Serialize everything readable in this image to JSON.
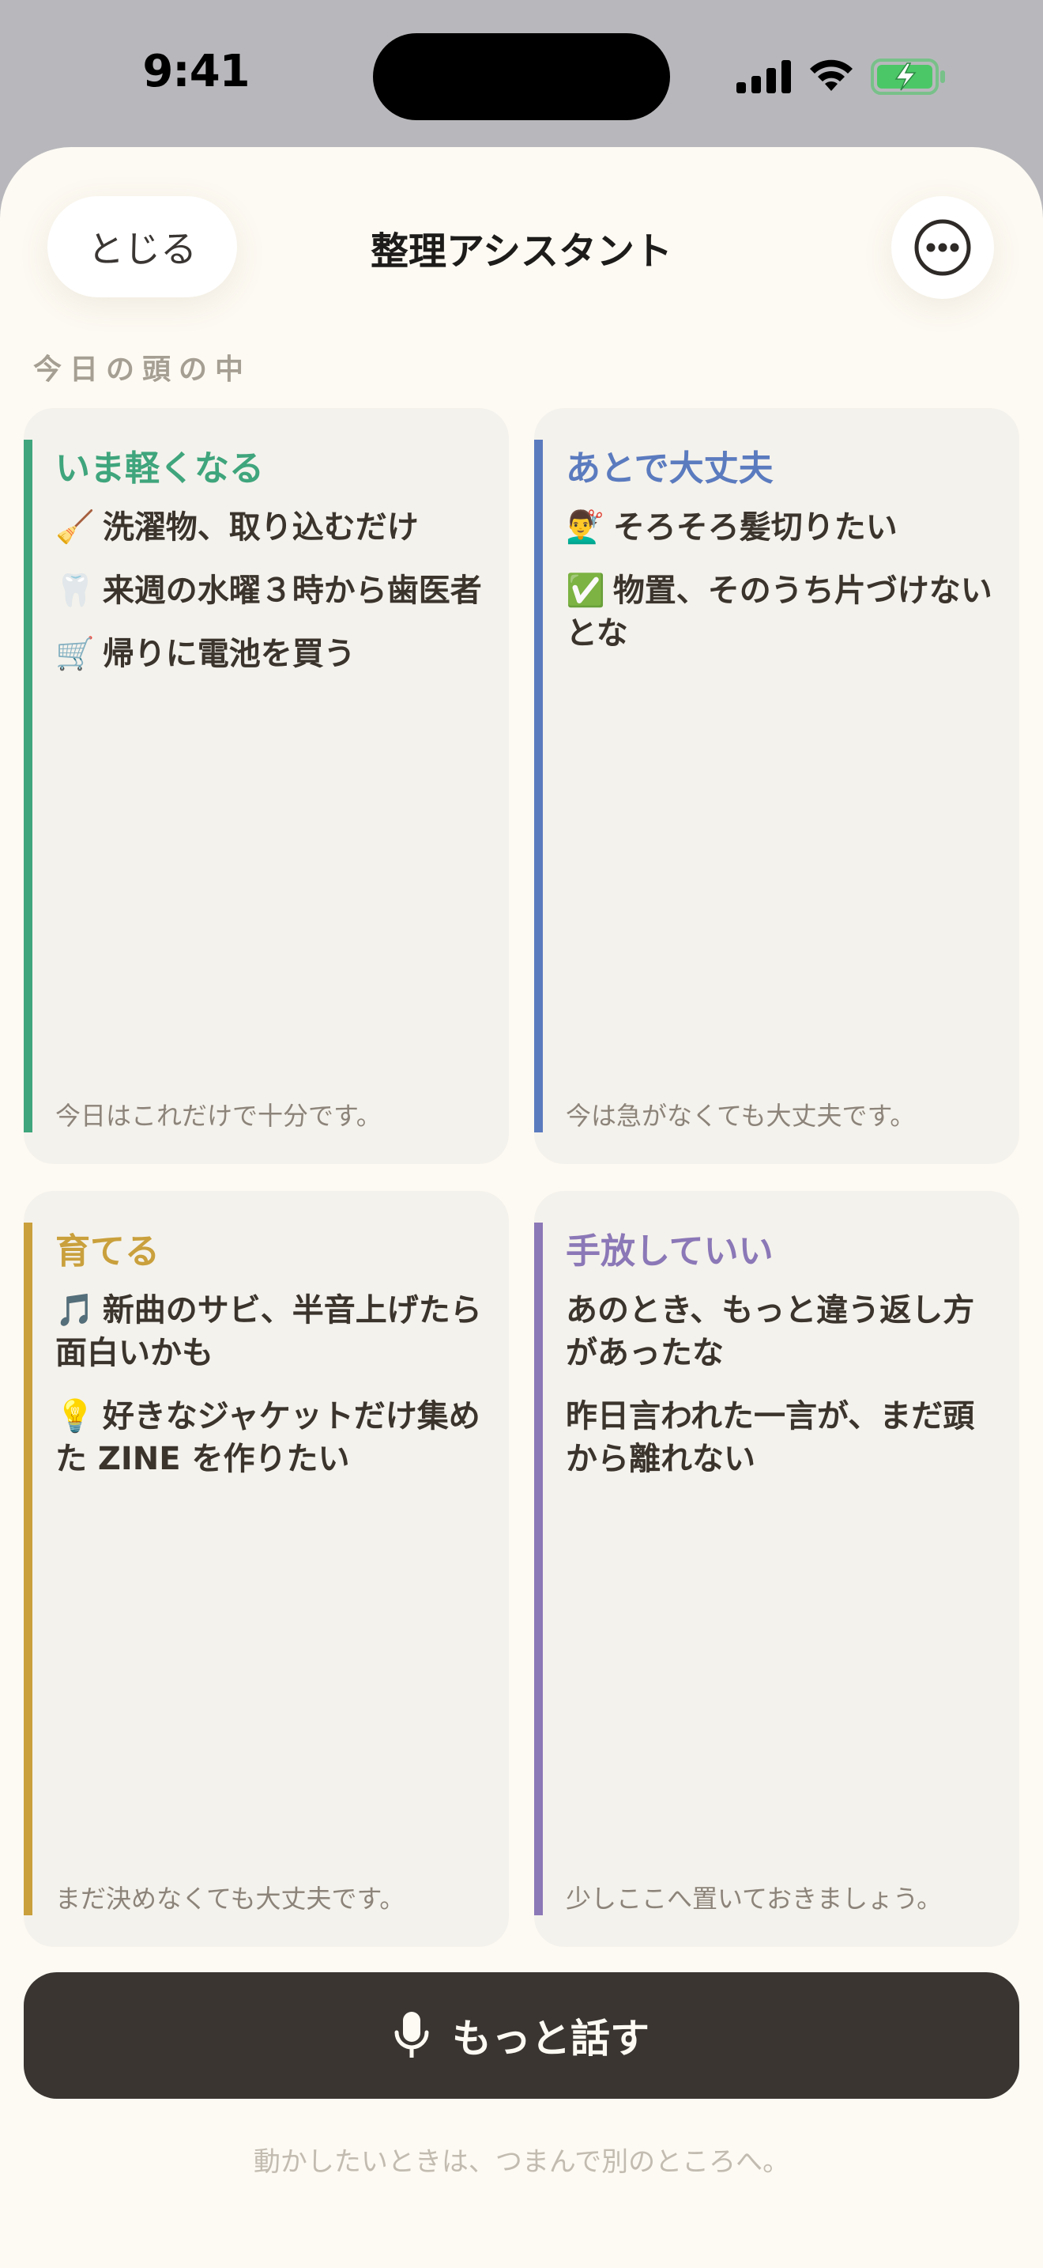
{
  "status_bar": {
    "time": "9:41",
    "icons": [
      "signal-icon",
      "wifi-icon",
      "battery-charging-icon"
    ],
    "battery_color": "#4cc767"
  },
  "header": {
    "close_label": "とじる",
    "title": "整理アシスタント",
    "more_icon": "ellipsis-circle-icon"
  },
  "section_label": "今日の頭の中",
  "cards": {
    "now": {
      "title": "いま軽くなる",
      "accent": "#3fa57c",
      "items": [
        {
          "emoji": "🧹",
          "text": "洗濯物、取り込むだけ"
        },
        {
          "emoji": "🦷",
          "text": "来週の水曜３時から歯医者"
        },
        {
          "emoji": "🛒",
          "text": "帰りに電池を買う"
        }
      ],
      "footer": "今日はこれだけで十分です。"
    },
    "later": {
      "title": "あとで大丈夫",
      "accent": "#5b7bbf",
      "items": [
        {
          "emoji": "💇‍♂️",
          "text": "そろそろ髪切りたい"
        },
        {
          "emoji": "✅",
          "text": "物置、そのうち片づけないとな"
        }
      ],
      "footer": "今は急がなくても大丈夫です。"
    },
    "grow": {
      "title": "育てる",
      "accent": "#c9a03c",
      "items": [
        {
          "emoji": "🎵",
          "text": "新曲のサビ、半音上げたら面白いかも"
        },
        {
          "emoji": "💡",
          "text": "好きなジャケットだけ集めた ZINE を作りたい"
        }
      ],
      "footer": "まだ決めなくても大丈夫です。"
    },
    "release": {
      "title": "手放していい",
      "accent": "#8b78b7",
      "items": [
        {
          "emoji": "",
          "text": "あのとき、もっと違う返し方があったな"
        },
        {
          "emoji": "",
          "text": "昨日言われた一言が、まだ頭から離れない"
        }
      ],
      "footer": "少しここへ置いておきましょう。"
    }
  },
  "talk_button": {
    "label": "もっと話す",
    "icon": "microphone-icon"
  },
  "hint": "動かしたいときは、つまんで別のところへ。"
}
